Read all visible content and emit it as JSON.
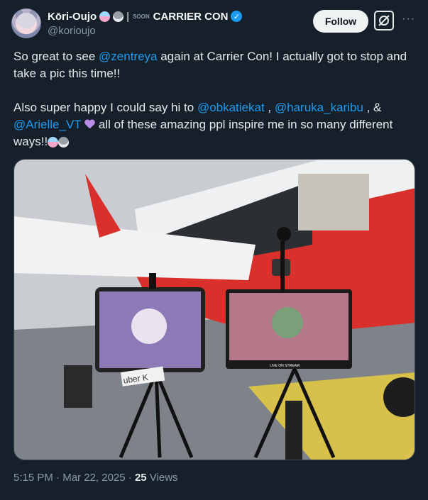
{
  "author": {
    "display_name": "Kōri-Oujo",
    "name_suffix_small": "SOON",
    "name_tail": "CARRIER CON",
    "handle": "@korioujo",
    "verified_icon": "verified-badge-icon"
  },
  "header": {
    "follow_label": "Follow",
    "grok_icon": "grok-icon",
    "more_label": "···"
  },
  "tweet": {
    "line1_pre": "So great to see ",
    "mention_zentreya": "@zentreya",
    "line1_post": " again at Carrier Con! I actually got to stop and take a pic this time!!",
    "line2_pre": "Also super happy I could say hi to ",
    "mention_obkatiekat": "@obkatiekat",
    "sep1": " , ",
    "mention_haruka": "@haruka_karibu",
    "sep2": " , & ",
    "mention_arielle": "@Arielle_VT",
    "line2_post": " all of these amazing ppl inspire me in so many different ways!!"
  },
  "photo": {
    "stream_label": "LIVE ON STREAM",
    "sign_text": "uber K"
  },
  "meta": {
    "time": "5:15 PM",
    "dot1": " · ",
    "date": "Mar 22, 2025",
    "dot2": " · ",
    "views": "25",
    "views_label": " Views"
  }
}
